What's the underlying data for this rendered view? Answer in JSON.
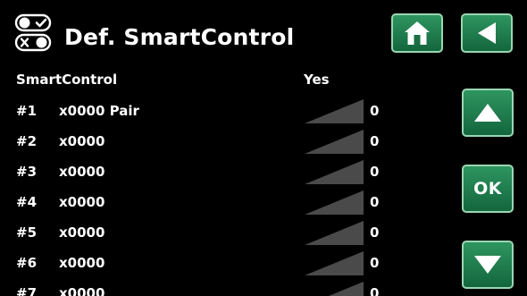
{
  "header": {
    "title": "Def. SmartControl",
    "icons": [
      "toggle-switches-icon",
      "home-icon",
      "back-arrow-icon"
    ]
  },
  "setting": {
    "label": "SmartControl",
    "value": "Yes"
  },
  "rows": [
    {
      "num": "#1",
      "name": "x0000 Pair",
      "value": "0"
    },
    {
      "num": "#2",
      "name": "x0000",
      "value": "0"
    },
    {
      "num": "#3",
      "name": "x0000",
      "value": "0"
    },
    {
      "num": "#4",
      "name": "x0000",
      "value": "0"
    },
    {
      "num": "#5",
      "name": "x0000",
      "value": "0"
    },
    {
      "num": "#6",
      "name": "x0000",
      "value": "0"
    },
    {
      "num": "#7",
      "name": "x0000",
      "value": "0"
    }
  ],
  "nav": {
    "ok_label": "OK",
    "icons": [
      "up-arrow-icon",
      "down-arrow-icon"
    ]
  },
  "colors": {
    "background": "#000000",
    "button_green": "#1f7a4a",
    "button_border": "#9ad6b2",
    "signal_bar": "#4a4a4a"
  }
}
